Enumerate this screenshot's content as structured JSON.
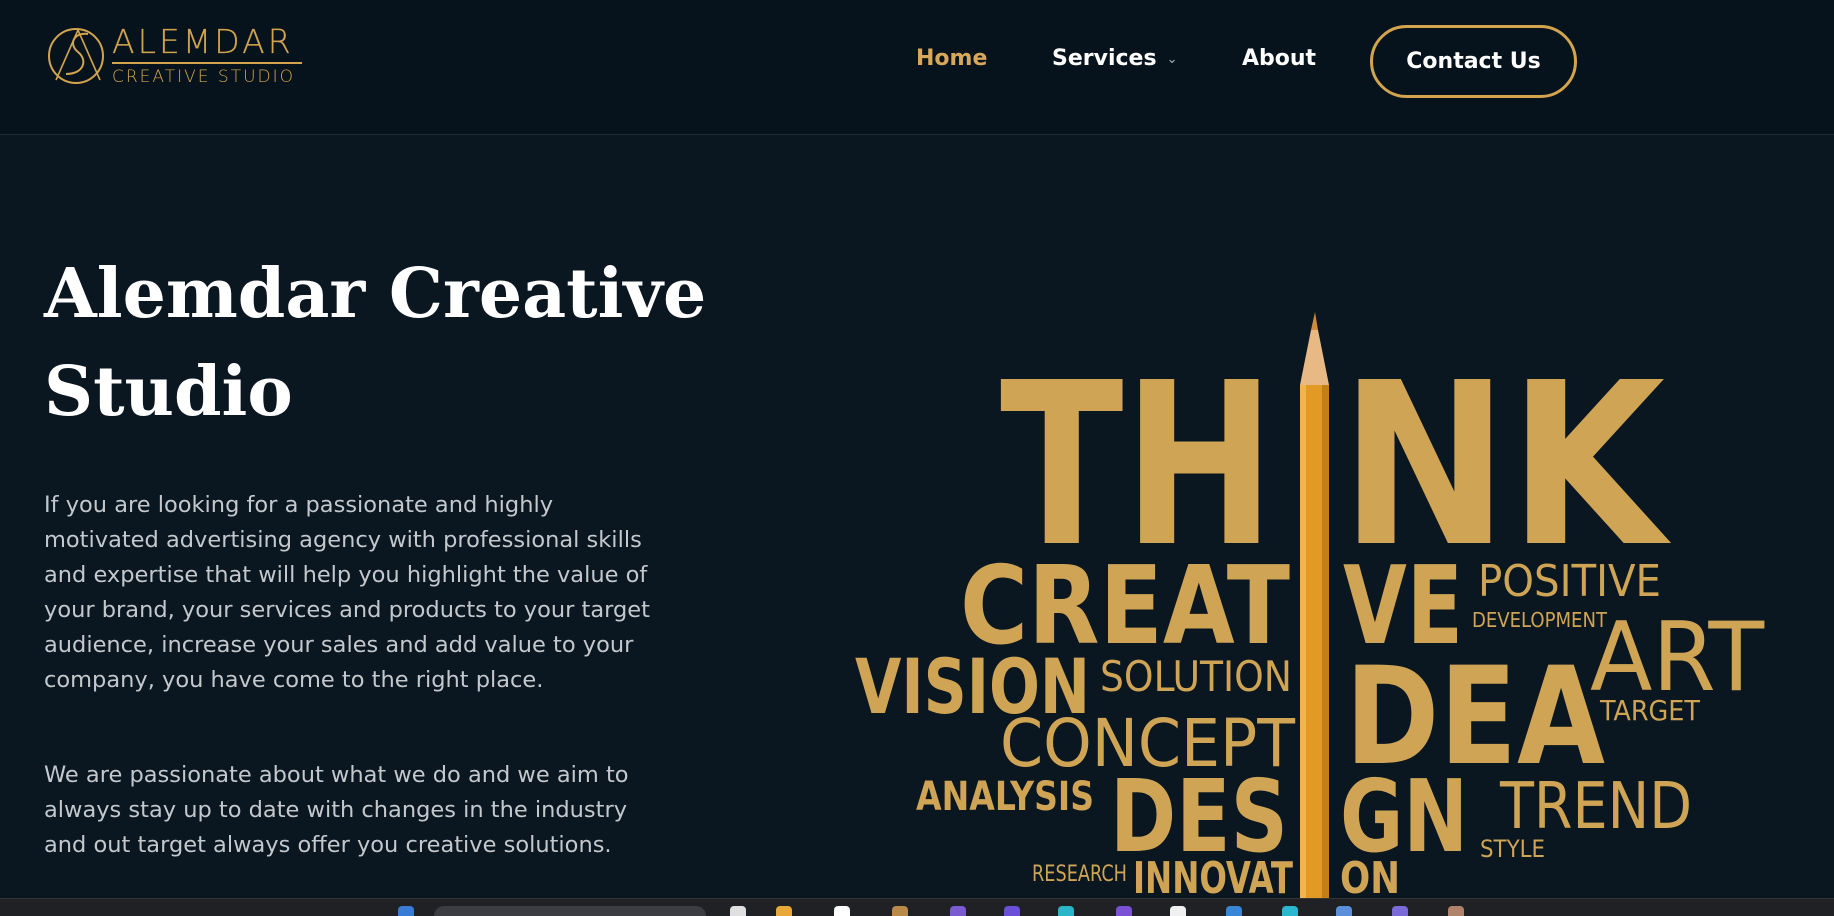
{
  "brand": {
    "name": "ALEMDAR",
    "subtitle": "CREATIVE STUDIO",
    "accent_color": "#d3a44e"
  },
  "nav": {
    "home": "Home",
    "services": "Services",
    "about": "About",
    "contact": "Contact Us"
  },
  "hero": {
    "title_line1": "Alemdar Creative",
    "title_line2": "Studio",
    "paragraph1": "If you are looking for a passionate and highly motivated advertising agency with professional skills and expertise that will help you highlight the value of your brand, your services and products to your target audience, increase your sales and add value to your company, you have come to the right place.",
    "paragraph2": "We are passionate about what we do and we aim to always stay up to date with changes in the industry and out target always offer you creative solutions."
  },
  "word_cloud": {
    "think_left": "TH",
    "think_right": "NK",
    "creat": "CREAT",
    "ve": "VE",
    "positive": "POSITIVE",
    "development": "DEVELOPMENT",
    "art": "ART",
    "vision": "VISION",
    "solution": "SOLUTION",
    "dea": "DEA",
    "target": "TARGET",
    "concept": "CONCEPT",
    "analysis": "ANALYSIS",
    "des": "DES",
    "gn": "GN",
    "trend": "TREND",
    "style": "STYLE",
    "research": "RESEARCH",
    "innovat": "INNOVAT",
    "on": "ON"
  }
}
